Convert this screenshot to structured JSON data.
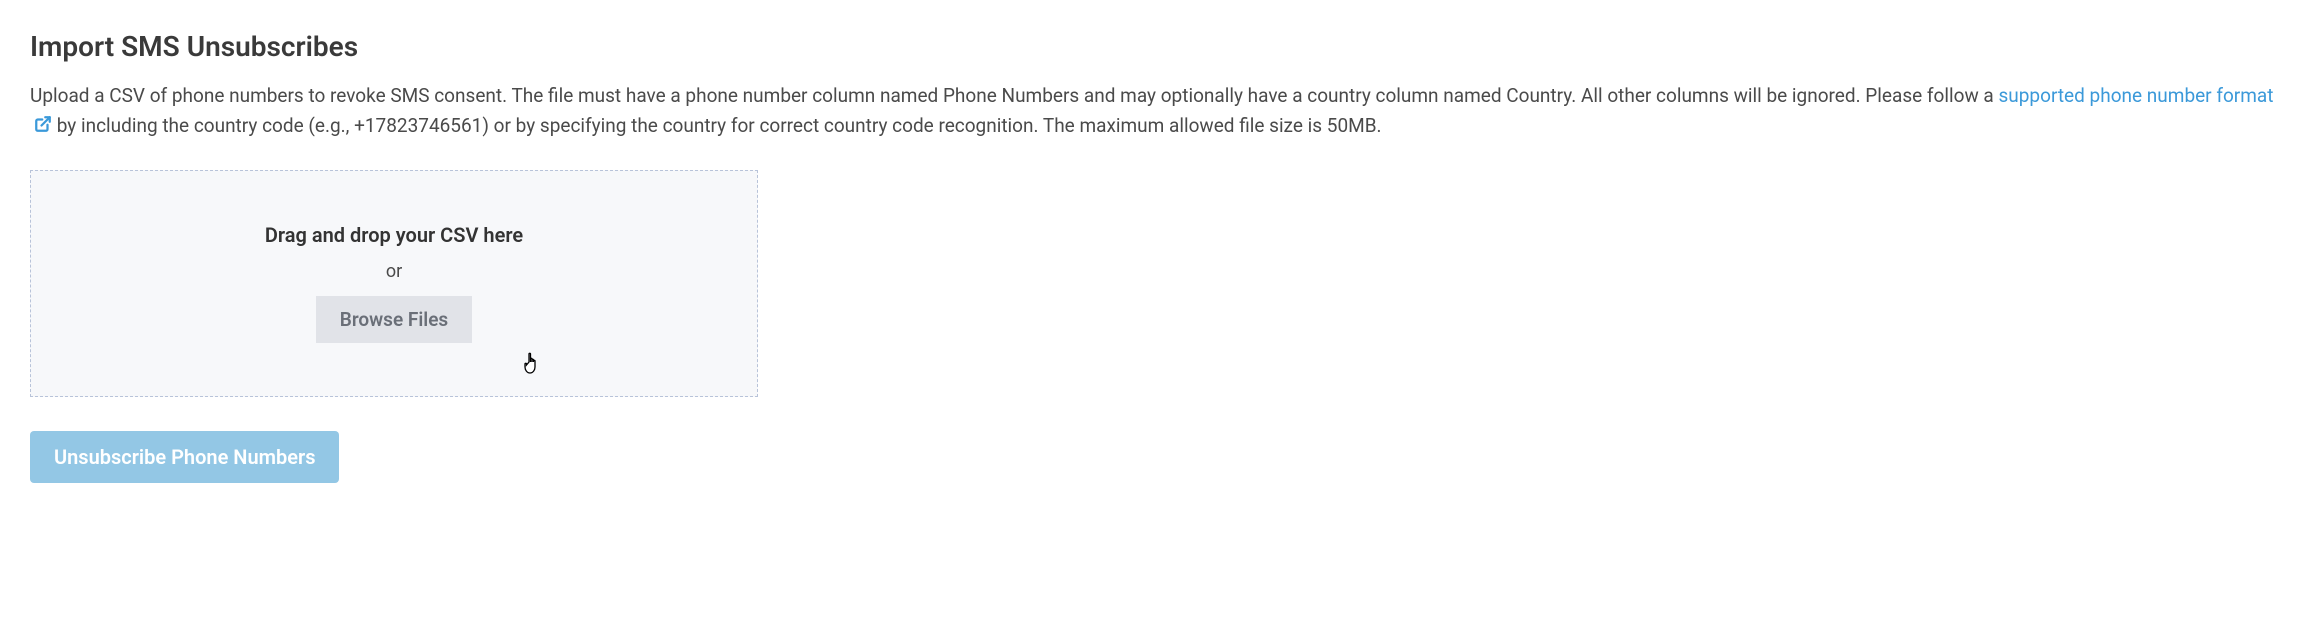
{
  "header": {
    "title": "Import SMS Unsubscribes"
  },
  "description": {
    "part1": "Upload a CSV of phone numbers to revoke SMS consent. The file must have a phone number column named Phone Numbers and may optionally have a country column named Country. All other columns will be ignored. Please follow a ",
    "link_text": "supported phone number format",
    "part2": " by including the country code (e.g., +17823746561) or by specifying the country for correct country code recognition. The maximum allowed file size is 50MB."
  },
  "dropzone": {
    "title": "Drag and drop your CSV here",
    "or_text": "or",
    "browse_label": "Browse Files"
  },
  "actions": {
    "submit_label": "Unsubscribe Phone Numbers"
  }
}
